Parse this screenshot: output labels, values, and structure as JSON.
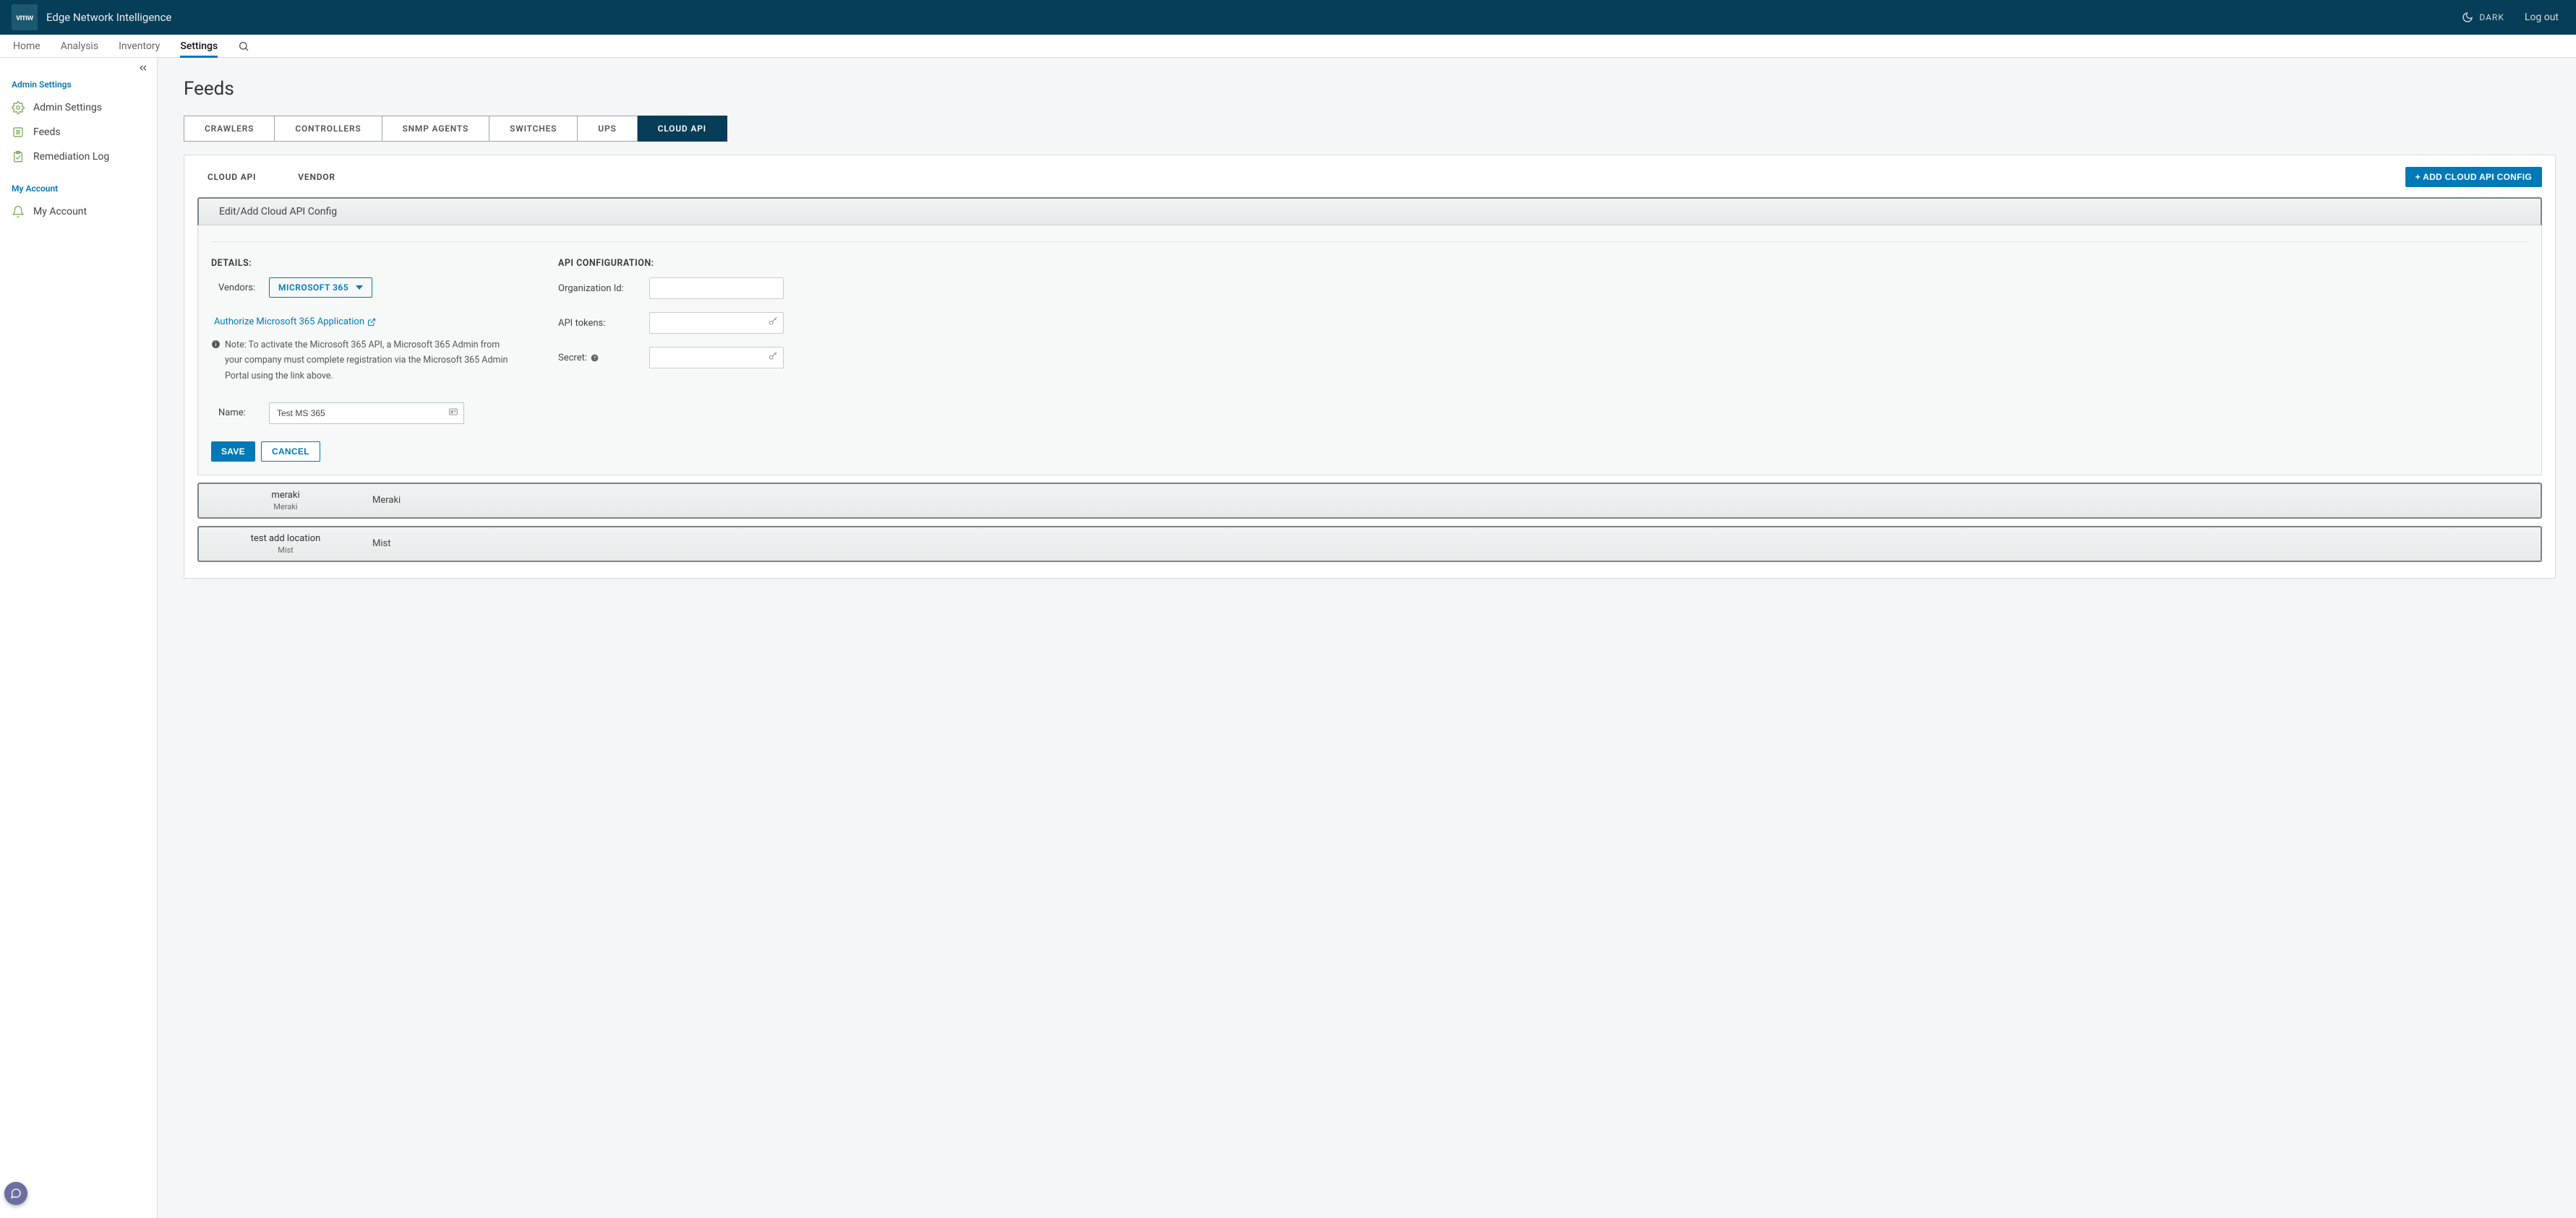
{
  "header": {
    "app_title": "Edge Network Intelligence",
    "logo_text": "vmw",
    "dark_label": "DARK",
    "logout_label": "Log out"
  },
  "mainnav": {
    "items": [
      "Home",
      "Analysis",
      "Inventory",
      "Settings"
    ],
    "active_index": 3
  },
  "sidebar": {
    "section_admin": "Admin Settings",
    "items_admin": [
      "Admin Settings",
      "Feeds",
      "Remediation Log"
    ],
    "section_account": "My Account",
    "items_account": [
      "My Account"
    ]
  },
  "page": {
    "title": "Feeds",
    "tabs": [
      "CRAWLERS",
      "CONTROLLERS",
      "SNMP AGENTS",
      "SWITCHES",
      "UPS",
      "CLOUD API"
    ],
    "active_tab_index": 5,
    "subtabs": [
      "CLOUD API",
      "VENDOR"
    ],
    "add_button": "+ ADD CLOUD API CONFIG",
    "config_header": "Edit/Add Cloud API Config",
    "details_label": "DETAILS:",
    "api_label": "API CONFIGURATION:",
    "vendors_label": "Vendors:",
    "vendor_selected": "MICROSOFT 365",
    "authorize_link": "Authorize Microsoft 365 Application",
    "note_text": "Note: To activate the Microsoft 365 API, a Microsoft 365 Admin from your company must complete registration via the Microsoft 365 Admin Portal using the link above.",
    "name_label": "Name:",
    "name_value": "Test MS 365",
    "org_label": "Organization Id:",
    "tokens_label": "API tokens:",
    "secret_label": "Secret:",
    "save_btn": "SAVE",
    "cancel_btn": "CANCEL",
    "rows": [
      {
        "title": "meraki",
        "subtitle": "Meraki",
        "vendor": "Meraki"
      },
      {
        "title": "test add location",
        "subtitle": "Mist",
        "vendor": "Mist"
      }
    ]
  }
}
